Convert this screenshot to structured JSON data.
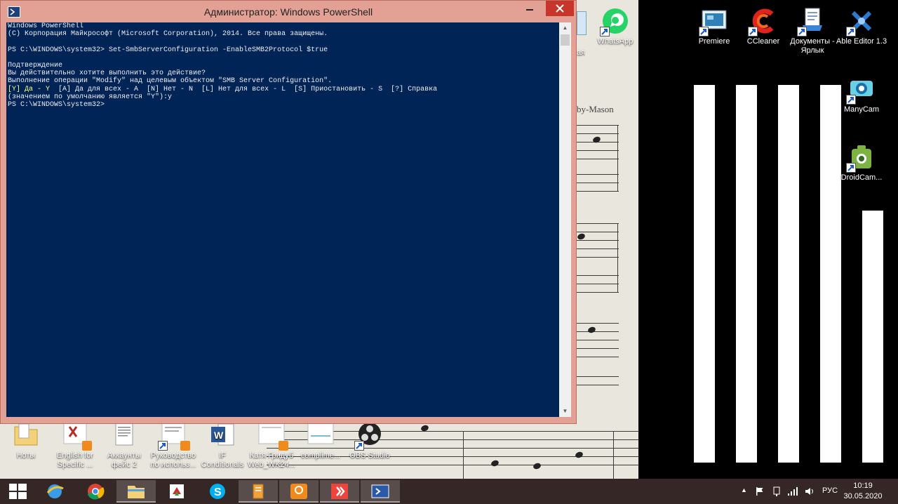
{
  "window": {
    "title": "Администратор: Windows PowerShell",
    "console_lines": [
      "Windows PowerShell",
      "(C) Корпорация Майкрософт (Microsoft Corporation), 2014. Все права защищены.",
      "",
      "PS C:\\WINDOWS\\system32> Set-SmbServerConfiguration -EnableSMB2Protocol $true",
      "",
      "Подтверждение",
      "Вы действительно хотите выполнить это действие?",
      "Выполнение операции \"Modify\" над целевым объектом \"SMB Server Configuration\".",
      "",
      "(значением по умолчанию является \"Y\"):y",
      "PS C:\\WINDOWS\\system32>"
    ],
    "prompt_choice_highlight": "[Y] Да - Y",
    "prompt_choice_rest": "  [A] Да для всех - A  [N] Нет - N  [L] Нет для всех - L  [S] Приостановить - S  [?] Справка"
  },
  "wallpaper": {
    "composer_text": "by-Mason"
  },
  "desktop_icons_right": [
    {
      "label": "WhatsApp"
    },
    {
      "label": "Premiere"
    },
    {
      "label": "CCleaner"
    },
    {
      "label": "Документы - Ярлык"
    },
    {
      "label": "Able Editor 1.3"
    },
    {
      "label": "ManyCam"
    },
    {
      "label": "DroidCam..."
    }
  ],
  "desktop_icons_bottom": [
    {
      "label": "Ноты"
    },
    {
      "label": "English for\nSpecific ..."
    },
    {
      "label": "Аккаунты\nфейс 2"
    },
    {
      "label": "Руководство\nпо использ..."
    },
    {
      "label": "IF\nConditionals"
    },
    {
      "label": "Катя Гридуб\nWeb_WK24..."
    },
    {
      "label": "complime..."
    },
    {
      "label": "OBS Studio"
    }
  ],
  "partial_icon_label": "ая",
  "tray": {
    "language": "РУС",
    "time": "10:19",
    "date": "30.05.2020"
  },
  "colors": {
    "console_bg": "#012456",
    "window_frame": "#e2a194",
    "close_button": "#c8352b"
  }
}
